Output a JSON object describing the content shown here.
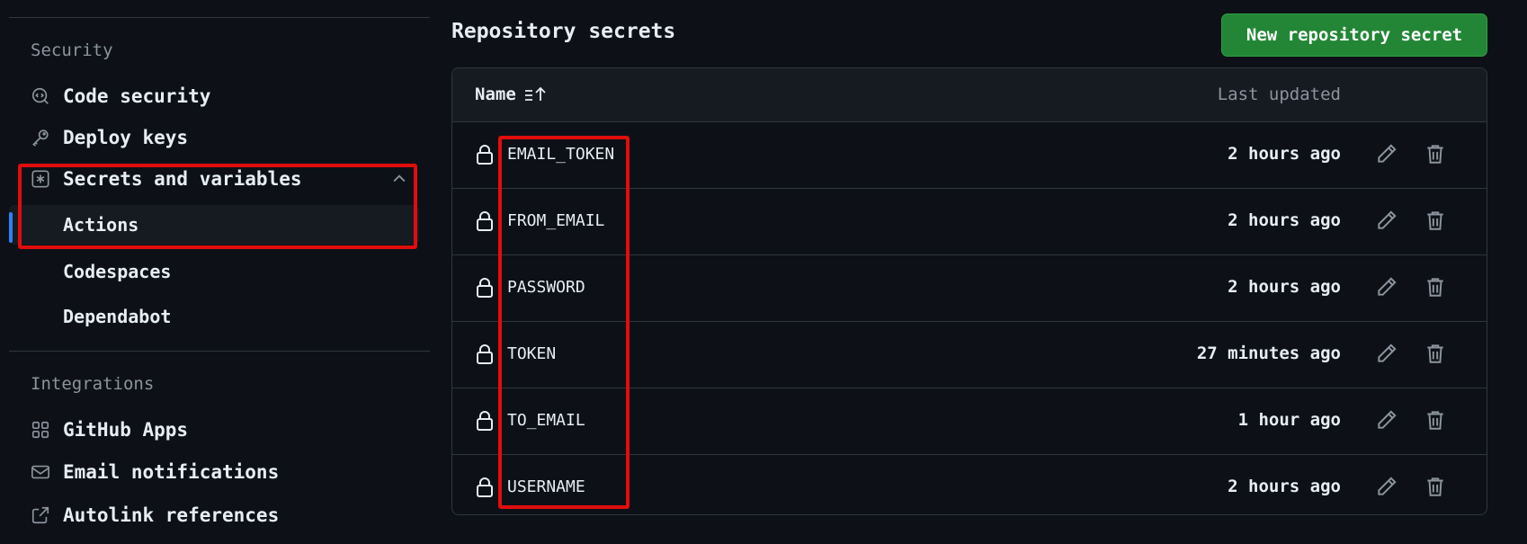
{
  "sidebar": {
    "security_heading": "Security",
    "integrations_heading": "Integrations",
    "items": [
      {
        "label": "Code security",
        "icon": "code-security-icon"
      },
      {
        "label": "Deploy keys",
        "icon": "key-icon"
      },
      {
        "label": "Secrets and variables",
        "icon": "asterisk-icon",
        "expanded": true
      },
      {
        "label": "Actions",
        "active": true
      },
      {
        "label": "Codespaces"
      },
      {
        "label": "Dependabot"
      },
      {
        "label": "GitHub Apps",
        "icon": "apps-icon"
      },
      {
        "label": "Email notifications",
        "icon": "mail-icon"
      },
      {
        "label": "Autolink references",
        "icon": "link-external-icon"
      }
    ]
  },
  "main": {
    "title": "Repository secrets",
    "new_button_label": "New repository secret",
    "table": {
      "col_name": "Name",
      "col_updated": "Last updated",
      "rows": [
        {
          "name": "EMAIL_TOKEN",
          "updated": "2 hours ago"
        },
        {
          "name": "FROM_EMAIL",
          "updated": "2 hours ago"
        },
        {
          "name": "PASSWORD",
          "updated": "2 hours ago"
        },
        {
          "name": "TOKEN",
          "updated": "27 minutes ago"
        },
        {
          "name": "TO_EMAIL",
          "updated": "1 hour ago"
        },
        {
          "name": "USERNAME",
          "updated": "2 hours ago"
        }
      ]
    }
  },
  "colors": {
    "background": "#0d1117",
    "accent_green": "#238636",
    "highlight_red": "#e00d0d",
    "active_blue": "#2f81f7"
  }
}
